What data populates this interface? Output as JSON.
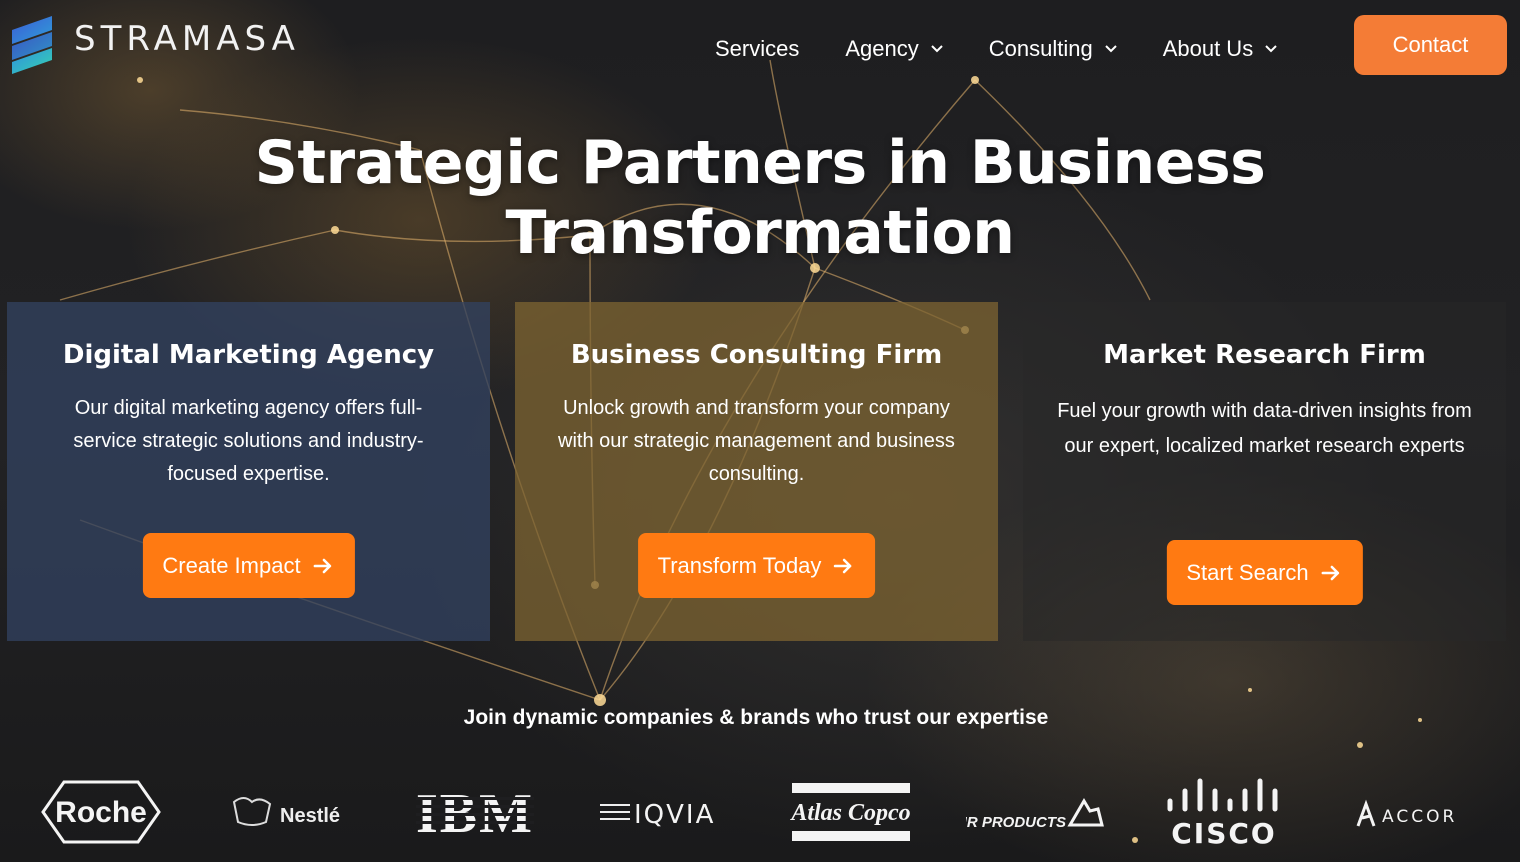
{
  "header": {
    "logo_text": "STRAMASA",
    "nav": [
      {
        "label": "Services",
        "has_dropdown": false
      },
      {
        "label": "Agency",
        "has_dropdown": true
      },
      {
        "label": "Consulting",
        "has_dropdown": true
      },
      {
        "label": "About Us",
        "has_dropdown": true
      }
    ],
    "contact_label": "Contact"
  },
  "hero": {
    "title": "Strategic Partners in Business Transformation"
  },
  "cards": [
    {
      "title": "Digital Marketing Agency",
      "description": "Our digital marketing agency offers full-service strategic solutions and industry-focused expertise.",
      "cta": "Create Impact"
    },
    {
      "title": "Business Consulting Firm",
      "description": "Unlock growth and transform your company with our strategic management and business consulting.",
      "cta": "Transform Today"
    },
    {
      "title": "Market Research Firm",
      "description": "Fuel your growth with data-driven insights from our expert, localized market research experts",
      "cta": "Start Search"
    }
  ],
  "trust": {
    "heading": "Join dynamic companies & brands who trust our expertise",
    "brands": [
      "Roche",
      "Nestlé",
      "IBM",
      "IQVIA",
      "Atlas Copco",
      "AIR PRODUCTS",
      "CISCO",
      "ACCOR"
    ]
  },
  "colors": {
    "accent": "#ff7a12",
    "contact": "#f47c36",
    "card_blue": "#32415f",
    "card_gold": "#7d6432",
    "card_dark": "#282828"
  }
}
